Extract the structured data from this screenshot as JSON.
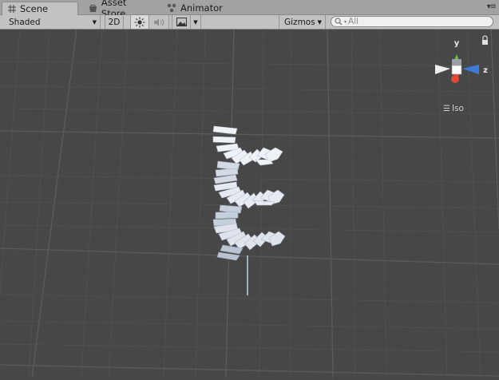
{
  "tabs": [
    {
      "label": "Scene",
      "icon": "hash-grid-icon",
      "active": true
    },
    {
      "label": "Asset Store",
      "icon": "shopping-bag-icon",
      "active": false
    },
    {
      "label": "Animator",
      "icon": "animator-nodes-icon",
      "active": false
    }
  ],
  "toolbar": {
    "draw_mode": "Shaded",
    "mode_2d": "2D",
    "gizmos_label": "Gizmos",
    "search_placeholder": "All"
  },
  "gizmo": {
    "axis_y": "y",
    "axis_z": "z",
    "projection": "Iso"
  },
  "colors": {
    "viewport_bg": "#474747",
    "grid_line": "#555555",
    "y_axis": "#6ac441",
    "z_axis": "#3d7bd9",
    "x_axis": "#e04a35",
    "mesh": "#e9edf3"
  }
}
